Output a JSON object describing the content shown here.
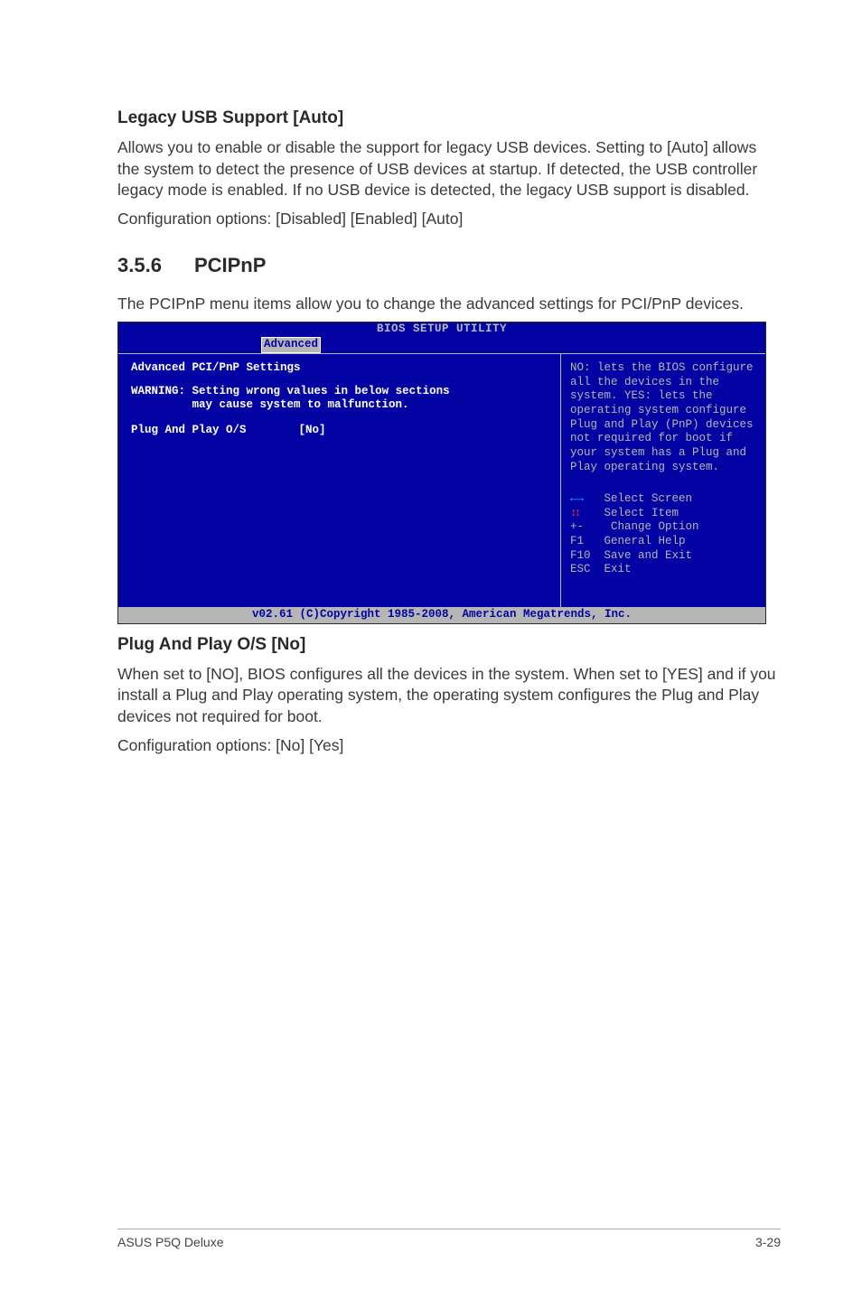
{
  "section1": {
    "title": "Legacy USB Support [Auto]",
    "p1": "Allows you to enable or disable the support for legacy USB devices. Setting to [Auto] allows the system to detect the presence of USB devices at startup. If detected, the USB controller legacy mode is enabled. If no USB device is detected, the legacy USB support is disabled.",
    "p2": "Configuration options: [Disabled] [Enabled] [Auto]"
  },
  "section2": {
    "number": "3.5.6",
    "title": "PCIPnP",
    "p1": "The PCIPnP menu items allow you to change the advanced settings for PCI/PnP devices."
  },
  "bios": {
    "utilityTitle": "BIOS SETUP UTILITY",
    "tab": "Advanced",
    "left": {
      "heading": "Advanced PCI/PnP Settings",
      "warnLabel": "WARNING:",
      "warnLine1": "Setting wrong values in below sections",
      "warnLine2": "may cause system to malfunction.",
      "itemLabel": "Plug And Play O/S",
      "itemValue": "[No]"
    },
    "right": {
      "help": "NO: lets the BIOS configure all the devices in the system. YES: lets the operating system configure Plug and Play (PnP) devices not required for boot if your system has a Plug and Play operating system.",
      "k1": "Select Screen",
      "k2": "Select Item",
      "k3lbl": "+-",
      "k3": "Change Option",
      "k4lbl": "F1",
      "k4": "General Help",
      "k5lbl": "F10",
      "k5": "Save and Exit",
      "k6lbl": "ESC",
      "k6": "Exit"
    },
    "footer": "v02.61 (C)Copyright 1985-2008, American Megatrends, Inc."
  },
  "section3": {
    "title": "Plug And Play O/S [No]",
    "p1": "When set to [NO], BIOS configures all the devices in the system. When set to [YES] and if you install a Plug and Play operating system, the operating system configures the Plug and Play devices not required for boot.",
    "p2": "Configuration options: [No] [Yes]"
  },
  "footer": {
    "left": "ASUS P5Q Deluxe",
    "right": "3-29"
  }
}
